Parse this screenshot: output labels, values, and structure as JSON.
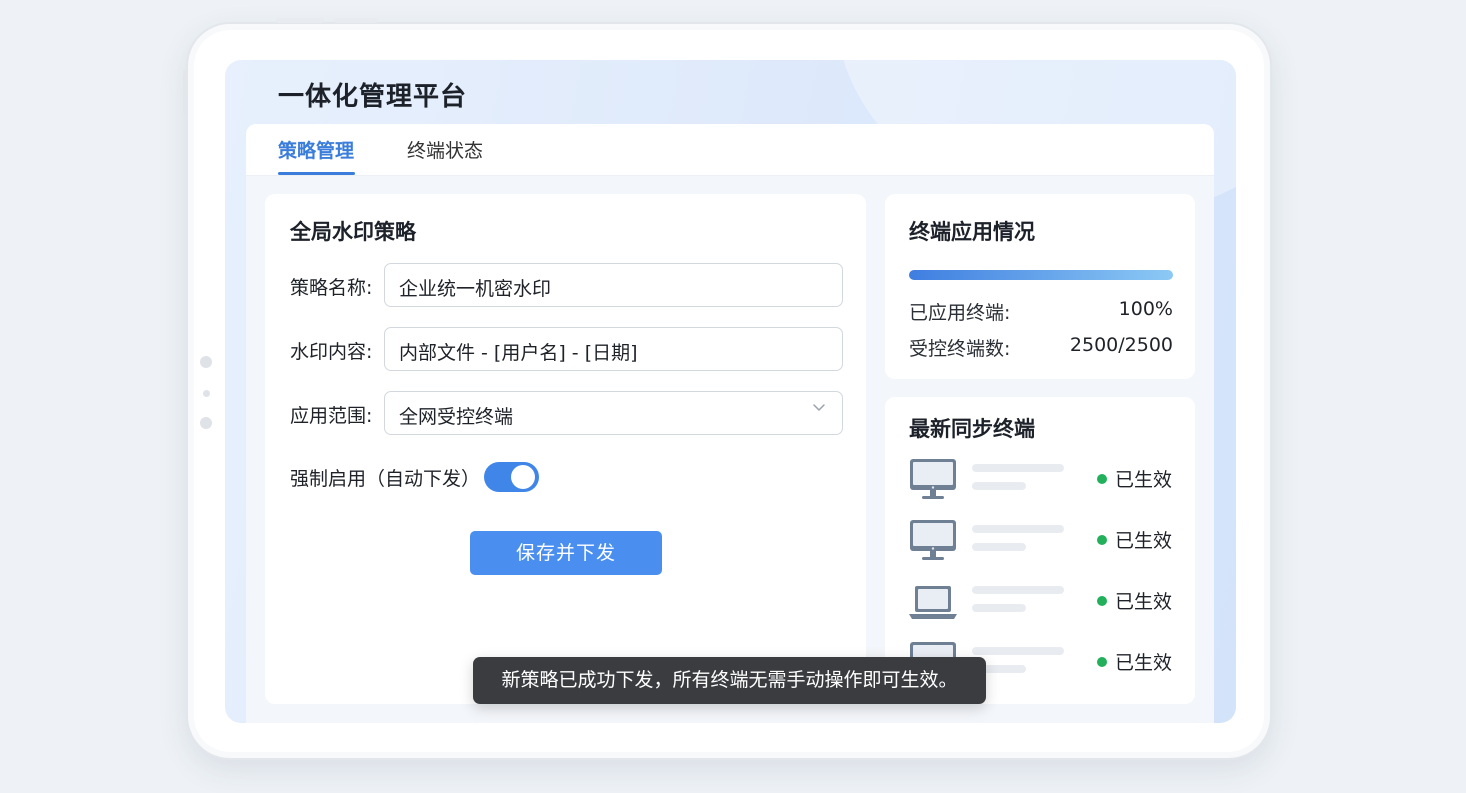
{
  "app": {
    "title": "一体化管理平台",
    "accent_color": "#3b7ddb"
  },
  "tabs": [
    {
      "label": "策略管理",
      "active": true
    },
    {
      "label": "终端状态",
      "active": false
    }
  ],
  "policy_form": {
    "title": "全局水印策略",
    "name_label": "策略名称:",
    "name_value": "企业统一机密水印",
    "content_label": "水印内容:",
    "content_value": "内部文件 - [用户名] - [日期]",
    "scope_label": "应用范围:",
    "scope_value": "全网受控终端",
    "force_label": "强制启用（自动下发）",
    "force_enabled": true,
    "save_label": "保存并下发"
  },
  "terminal_usage": {
    "title": "终端应用情况",
    "progress_fraction": 1.0,
    "applied_label": "已应用终端:",
    "applied_value": "100%",
    "controlled_label": "受控终端数:",
    "controlled_value": "2500/2500"
  },
  "latest_sync": {
    "title": "最新同步终端",
    "status_color": "#22b05b",
    "devices": [
      {
        "type": "monitor-icon",
        "status": "已生效"
      },
      {
        "type": "monitor-icon",
        "status": "已生效"
      },
      {
        "type": "laptop-icon",
        "status": "已生效"
      },
      {
        "type": "monitor-icon",
        "status": "已生效"
      }
    ]
  },
  "toast": {
    "message": "新策略已成功下发，所有终端无需手动操作即可生效。"
  }
}
